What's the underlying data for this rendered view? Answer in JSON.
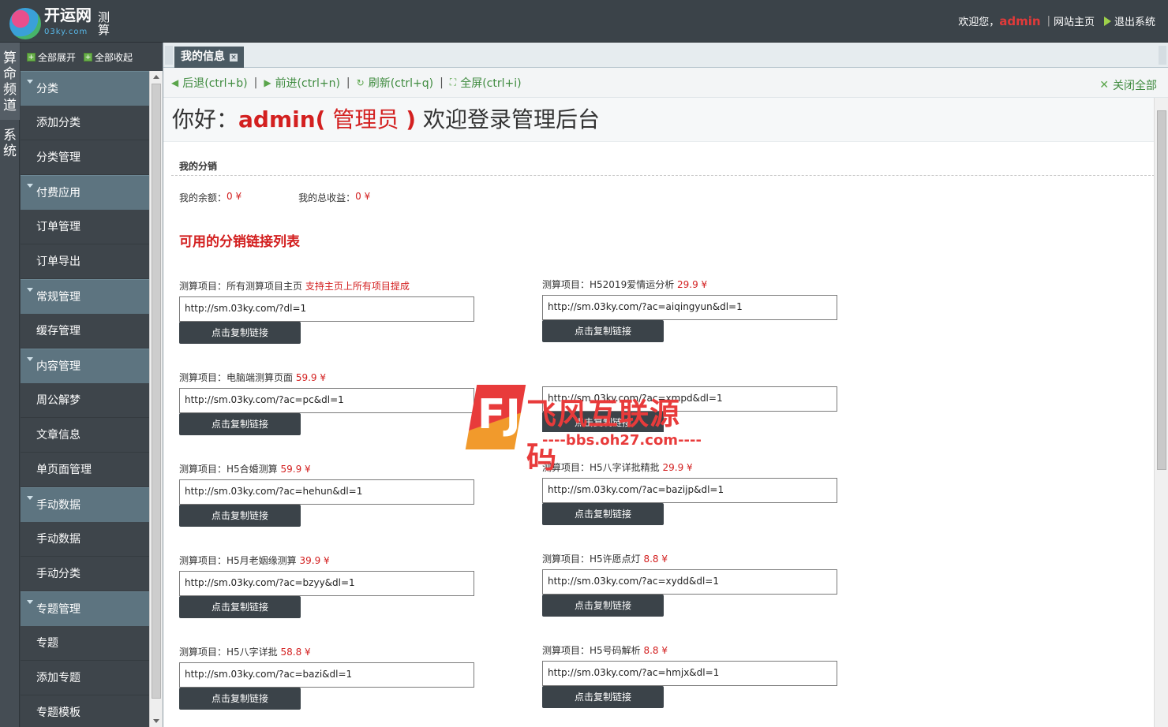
{
  "header": {
    "brand": "开运网",
    "brand_sub": "03ky.com",
    "brand_side": "测算",
    "welcome_prefix": "欢迎您，",
    "user": "admin",
    "site_home": "网站主页",
    "logout": "退出系统"
  },
  "vstrip": {
    "tab1": "算命频道",
    "tab2": "系统"
  },
  "sidebar": {
    "expand_all": "全部展开",
    "collapse_all": "全部收起",
    "groups": [
      {
        "label": "分类",
        "items": [
          "添加分类",
          "分类管理"
        ]
      },
      {
        "label": "付费应用",
        "items": [
          "订单管理",
          "订单导出"
        ]
      },
      {
        "label": "常规管理",
        "items": [
          "缓存管理"
        ]
      },
      {
        "label": "内容管理",
        "items": [
          "周公解梦",
          "文章信息",
          "单页面管理"
        ]
      },
      {
        "label": "手动数据",
        "items": [
          "手动数据",
          "手动分类"
        ]
      },
      {
        "label": "专题管理",
        "items": [
          "专题",
          "添加专题",
          "专题模板"
        ]
      }
    ]
  },
  "tabs": {
    "active": "我的信息",
    "close": "×"
  },
  "toolbar": {
    "back": "后退(ctrl+b)",
    "forward": "前进(ctrl+n)",
    "refresh": "刷新(ctrl+q)",
    "fullscreen": "全屏(ctrl+i)",
    "close_all": "关闭全部"
  },
  "welcome": {
    "prefix": "你好：",
    "user": "admin(",
    "role": " 管理员 ",
    "close_paren": ")",
    "suffix": " 欢迎登录管理后台"
  },
  "distribution": {
    "title": "我的分销",
    "balance_label": "我的余额：",
    "balance_value": "0 ¥",
    "earnings_label": "我的总收益：",
    "earnings_value": "0 ¥",
    "list_title": "可用的分销链接列表",
    "copy_label": "点击复制链接",
    "left": [
      {
        "label": "测算项目：所有测算项目主页 ",
        "price": "支持主页上所有项目提成",
        "url": "http://sm.03ky.com/?dl=1"
      },
      {
        "label": "测算项目：电脑端测算页面 ",
        "price": "59.9 ¥",
        "url": "http://sm.03ky.com/?ac=pc&dl=1"
      },
      {
        "label": "测算项目：H5合婚测算 ",
        "price": "59.9 ¥",
        "url": "http://sm.03ky.com/?ac=hehun&dl=1"
      },
      {
        "label": "测算项目：H5月老姻缘测算 ",
        "price": "39.9 ¥",
        "url": "http://sm.03ky.com/?ac=bzyy&dl=1"
      },
      {
        "label": "测算项目：H5八字详批 ",
        "price": "58.8 ¥",
        "url": "http://sm.03ky.com/?ac=bazi&dl=1"
      }
    ],
    "right": [
      {
        "label": "测算项目：H52019爱情运分析 ",
        "price": "29.9 ¥",
        "url": "http://sm.03ky.com/?ac=aiqingyun&dl=1"
      },
      {
        "label": "",
        "price": "",
        "url": "http://sm.03ky.com/?ac=xmpd&dl=1"
      },
      {
        "label": "测算项目：H5八字详批精批 ",
        "price": "29.9 ¥",
        "url": "http://sm.03ky.com/?ac=bazijp&dl=1"
      },
      {
        "label": "测算项目：H5许愿点灯 ",
        "price": "8.8 ¥",
        "url": "http://sm.03ky.com/?ac=xydd&dl=1"
      },
      {
        "label": "测算项目：H5号码解析 ",
        "price": "8.8 ¥",
        "url": "http://sm.03ky.com/?ac=hmjx&dl=1"
      }
    ]
  },
  "watermark": {
    "mark": "FJ",
    "title": "飞风互联源码",
    "url": "----bbs.oh27.com----"
  },
  "colors": {
    "header_bg": "#3b4349",
    "accent_red": "#d32020",
    "menu_group_bg": "#5d7480",
    "toolbar_green": "#3f8b3f"
  }
}
